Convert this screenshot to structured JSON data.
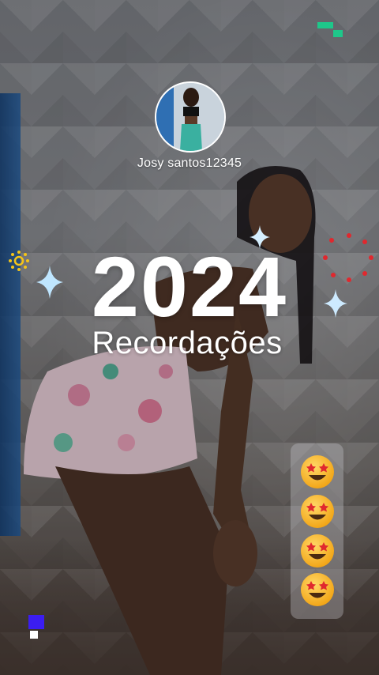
{
  "profile": {
    "username": "Josy santos12345"
  },
  "title": {
    "year": "2024",
    "subtitle": "Recordações"
  },
  "reactions": [
    {
      "emoji": "star-struck-emoji-icon"
    },
    {
      "emoji": "star-struck-emoji-icon"
    },
    {
      "emoji": "star-struck-emoji-icon"
    },
    {
      "emoji": "star-struck-emoji-icon"
    }
  ],
  "colors": {
    "accent_green": "#1ec78a",
    "sparkle_gold": "#f5c518",
    "dots_red": "#e0282e",
    "mark_purple": "#3b1df2"
  }
}
